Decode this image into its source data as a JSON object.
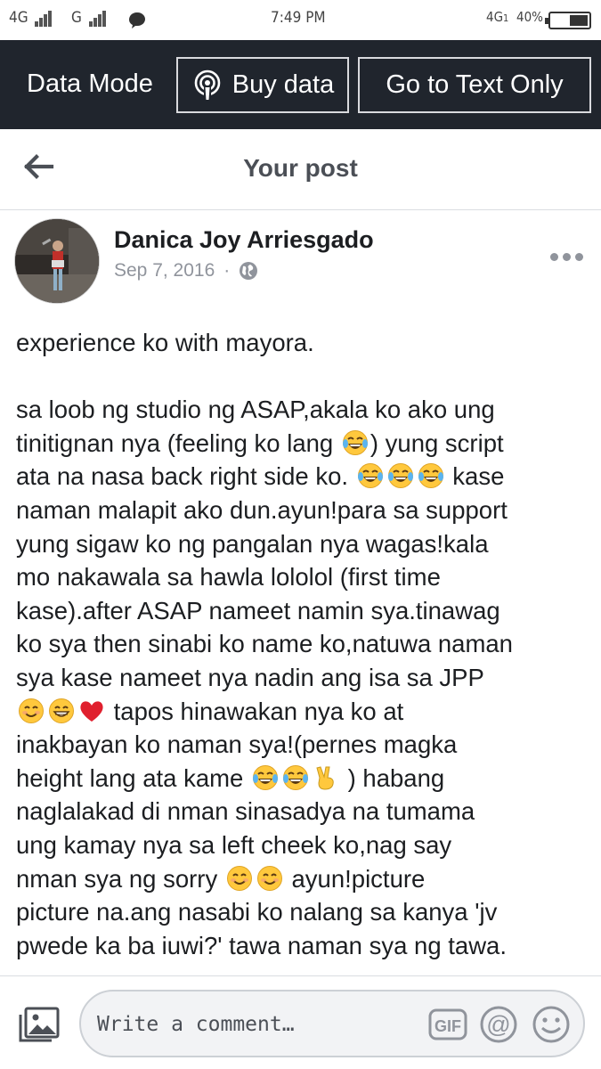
{
  "status_bar": {
    "net1": "4G",
    "net2": "G",
    "time": "7:49 PM",
    "net3": "4G",
    "net3_sub": "1",
    "battery": "40%"
  },
  "data_bar": {
    "label": "Data Mode",
    "buy_label": "Buy data",
    "text_only_label": "Go to Text Only"
  },
  "header": {
    "title": "Your post"
  },
  "post": {
    "author": "Danica Joy Arriesgado",
    "date": "Sep 7, 2016",
    "separator": "·",
    "lines": [
      [
        "experience ko with mayora."
      ],
      [
        ""
      ],
      [
        "sa loob ng studio ng ASAP,akala ko ako ung"
      ],
      [
        "tinitignan nya (feeling ko lang ",
        "😂",
        ") yung script"
      ],
      [
        "ata na nasa back right side ko. ",
        "😂",
        "😂",
        "😂",
        " kase"
      ],
      [
        "naman malapit ako dun.ayun!para sa support"
      ],
      [
        "yung sigaw ko ng pangalan nya wagas!kala"
      ],
      [
        "mo nakawala sa hawla lololol (first time"
      ],
      [
        "kase).after ASAP nameet namin sya.tinawag"
      ],
      [
        "ko sya then sinabi ko name ko,natuwa naman"
      ],
      [
        "sya kase nameet nya nadin ang isa sa JPP"
      ],
      [
        "😊",
        "😁",
        "❤",
        " tapos hinawakan nya ko at"
      ],
      [
        "inakbayan ko naman sya!(pernes magka"
      ],
      [
        "height lang ata kame ",
        "😂",
        "😂",
        "✌",
        " ) habang"
      ],
      [
        "naglalakad di nman sinasadya na tumama"
      ],
      [
        "ung kamay nya sa left cheek ko,nag say"
      ],
      [
        "nman sya ng sorry ",
        "😊",
        "😊",
        " ayun!picture"
      ],
      [
        "picture na.ang nasabi ko nalang sa kanya 'jv"
      ],
      [
        "pwede ka ba iuwi?' tawa naman sya ng tawa."
      ]
    ]
  },
  "comment_bar": {
    "placeholder": "Write a comment…",
    "gif_label": "GIF",
    "at_label": "@"
  },
  "icons": {
    "back": "back-arrow-icon",
    "podcast": "broadcast-icon",
    "globe": "globe-icon",
    "more": "more-options-icon",
    "photo": "photo-icon",
    "smile": "smiley-icon"
  },
  "colors": {
    "data_bar_bg": "#20252d",
    "text_primary": "#1c1e21",
    "text_secondary": "#90949c",
    "emoji_yellow": "#ffc83d",
    "heart": "#e0202e"
  }
}
